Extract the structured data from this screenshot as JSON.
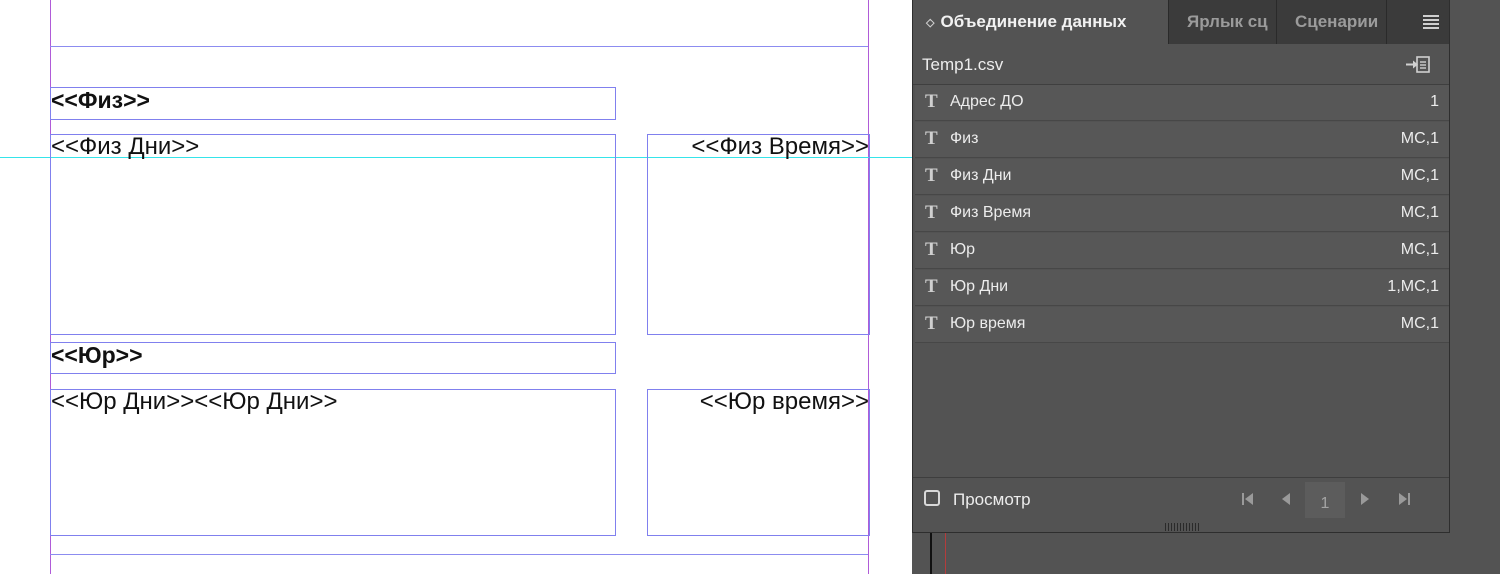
{
  "document": {
    "frames": [
      {
        "id": "fiz",
        "text": "<<Физ>>",
        "bold": true,
        "align": "left"
      },
      {
        "id": "fiz-days",
        "text": "<<Физ Дни>>",
        "bold": false,
        "align": "left"
      },
      {
        "id": "fiz-time",
        "text": "<<Физ Время>>",
        "bold": false,
        "align": "right"
      },
      {
        "id": "yur",
        "text": "<<Юр>>",
        "bold": true,
        "align": "left"
      },
      {
        "id": "yur-days",
        "text": "<<Юр Дни>><<Юр Дни>>",
        "bold": false,
        "align": "left"
      },
      {
        "id": "yur-time",
        "text": "<<Юр время>>",
        "bold": false,
        "align": "right"
      }
    ]
  },
  "panel": {
    "tabs": [
      {
        "label": "Объединение данных",
        "active": true
      },
      {
        "label": "Ярлык сц",
        "active": false
      },
      {
        "label": "Сценарии",
        "active": false
      }
    ],
    "menu_icon": "hamburger-menu-icon",
    "source_file": "Temp1.csv",
    "import_icon": "import-data-icon",
    "fields": [
      {
        "name": "Адрес ДО",
        "value": "1"
      },
      {
        "name": "Физ",
        "value": "MC,1"
      },
      {
        "name": "Физ Дни",
        "value": "MC,1"
      },
      {
        "name": "Физ Время",
        "value": "MC,1"
      },
      {
        "name": "Юр",
        "value": "MC,1"
      },
      {
        "name": "Юр Дни",
        "value": "1,MC,1"
      },
      {
        "name": "Юр время",
        "value": "MC,1"
      }
    ],
    "field_type_icon": "T",
    "preview_label": "Просмотр",
    "preview_checked": false,
    "page_number": "1",
    "nav_icons": [
      "first-record-icon",
      "previous-record-icon",
      "next-record-icon",
      "last-record-icon"
    ]
  }
}
